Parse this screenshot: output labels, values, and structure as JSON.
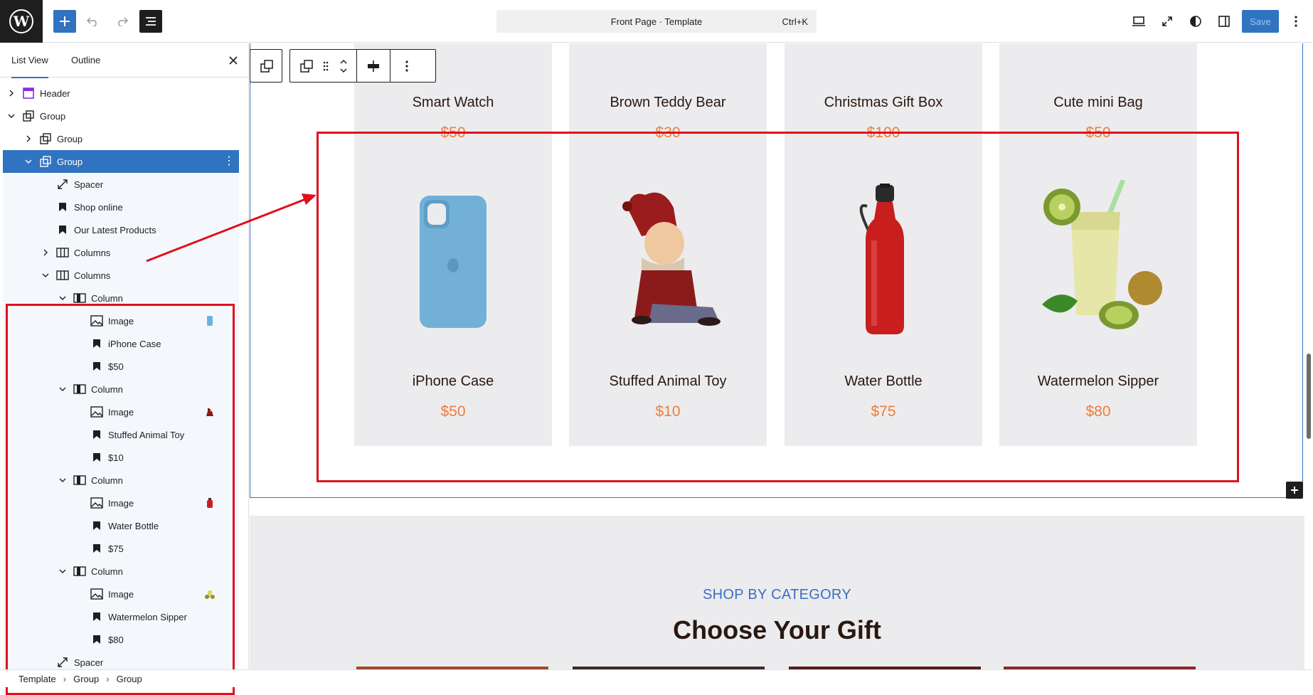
{
  "topbar": {
    "command_title": "Front Page · Template",
    "command_shortcut": "Ctrl+K",
    "save_label": "Save"
  },
  "sidebar": {
    "tabs": [
      "List View",
      "Outline"
    ],
    "rows": [
      {
        "label": "Header"
      },
      {
        "label": "Group"
      },
      {
        "label": "Group"
      },
      {
        "label": "Group"
      },
      {
        "label": "Spacer"
      },
      {
        "label": "Shop online"
      },
      {
        "label": "Our Latest Products"
      },
      {
        "label": "Columns"
      },
      {
        "label": "Columns"
      },
      {
        "label": "Column"
      },
      {
        "label": "Image"
      },
      {
        "label": "iPhone Case"
      },
      {
        "label": "$50"
      },
      {
        "label": "Column"
      },
      {
        "label": "Image"
      },
      {
        "label": "Stuffed Animal Toy"
      },
      {
        "label": "$10"
      },
      {
        "label": "Column"
      },
      {
        "label": "Image"
      },
      {
        "label": "Water Bottle"
      },
      {
        "label": "$75"
      },
      {
        "label": "Column"
      },
      {
        "label": "Image"
      },
      {
        "label": "Watermelon Sipper"
      },
      {
        "label": "$80"
      },
      {
        "label": "Spacer"
      }
    ]
  },
  "breadcrumb": [
    "Template",
    "Group",
    "Group"
  ],
  "canvas": {
    "top_products": [
      {
        "name": "Smart Watch",
        "price": "$50"
      },
      {
        "name": "Brown Teddy Bear",
        "price": "$30"
      },
      {
        "name": "Christmas Gift Box",
        "price": "$100"
      },
      {
        "name": "Cute mini Bag",
        "price": "$50"
      }
    ],
    "products": [
      {
        "name": "iPhone Case",
        "price": "$50"
      },
      {
        "name": "Stuffed Animal Toy",
        "price": "$10"
      },
      {
        "name": "Water Bottle",
        "price": "$75"
      },
      {
        "name": "Watermelon Sipper",
        "price": "$80"
      }
    ],
    "category_eyebrow": "SHOP BY CATEGORY",
    "category_title": "Choose Your Gift"
  },
  "colors": {
    "accent": "#3073c0",
    "price": "#ef7d3c",
    "highlight": "#e0101e"
  }
}
